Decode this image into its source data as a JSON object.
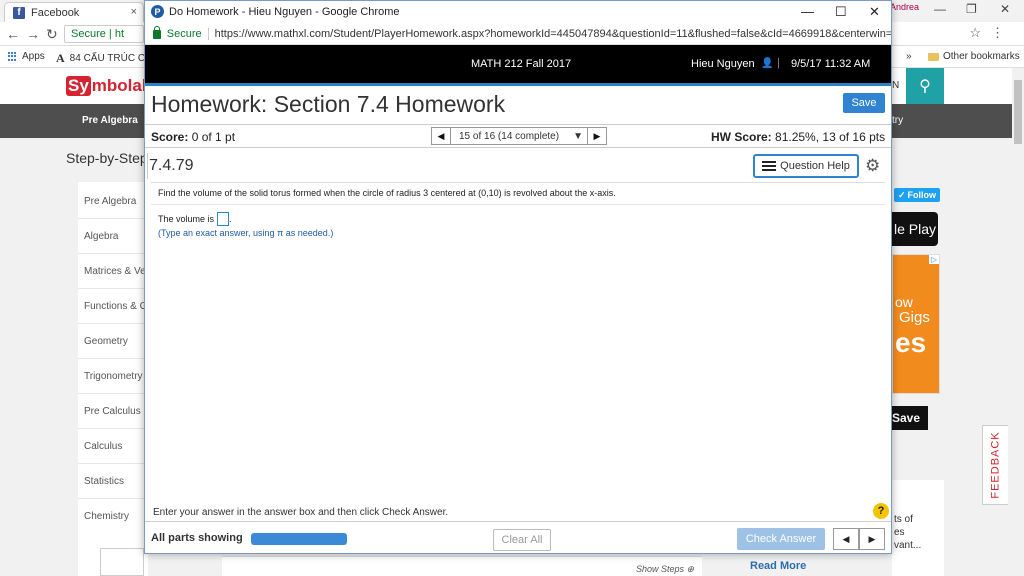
{
  "background": {
    "tab_title": "Facebook",
    "tab_close": "×",
    "window_controls": [
      "—",
      "❐",
      "✕"
    ],
    "window_partial_label": "Andrea",
    "omnibox_prefix": "Secure | ht",
    "bookmarks": {
      "apps_label": "Apps",
      "item1_prefix": "A",
      "item1_label": "84 CẤU TRÚC CÂ",
      "more": "»",
      "other_label": "Other bookmarks"
    },
    "symbolab": {
      "logo_sy": "Sy",
      "logo_rest": "mbolab",
      "nav_item": "Pre Algebra",
      "nav_right": "try",
      "hidden_n": "N",
      "page_title": "Step-by-Step",
      "sidebar_items": [
        "Pre Algebra",
        "Algebra",
        "Matrices & Ve",
        "Functions & G",
        "Geometry",
        "Trigonometry",
        "Pre Calculus",
        "Calculus",
        "Statistics",
        "Chemistry"
      ],
      "follow_label": "Follow",
      "gplay_label": "le Play",
      "ad_badge": "▷",
      "ad_low": "ow",
      "ad_gigs": "Gigs",
      "ad_es": "es",
      "ad_save": "Save",
      "feedback_label": "FEEDBACK",
      "lower_text": [
        "ts of",
        "es",
        "vant..."
      ],
      "show_steps": "Show Steps",
      "read_more": "Read More"
    }
  },
  "popup": {
    "icon_letter": "P",
    "window_title": "Do Homework - Hieu Nguyen - Google Chrome",
    "window_controls": [
      "—",
      "☐",
      "✕"
    ],
    "secure_label": "Secure",
    "url": "https://www.mathxl.com/Student/PlayerHomework.aspx?homeworkId=445047894&questionId=11&flushed=false&cId=4669918&centerwin=yes",
    "course_name": "MATH 212 Fall 2017",
    "user_name": "Hieu Nguyen",
    "user_icon": "👤",
    "separator": "|",
    "datetime": "9/5/17 11:32 AM",
    "hw_title": "Homework: Section 7.4 Homework",
    "save_label": "Save",
    "score_prefix": "Score:",
    "score_value": "0 of 1 pt",
    "question_nav": "15 of 16 (14 complete)",
    "hw_score_prefix": "HW Score:",
    "hw_score_value": "81.25%, 13 of 16 pts",
    "question_number": "7.4.79",
    "question_help_label": "Question Help",
    "question_text": "Find the volume of the solid torus formed when the circle of radius 3 centered at (0,10) is revolved about the x-axis.",
    "answer_prefix": "The volume is",
    "answer_suffix": ".",
    "answer_hint": "(Type an exact answer, using π as needed.)",
    "instruction": "Enter your answer in the answer box and then click Check Answer.",
    "help_symbol": "?",
    "parts_label": "All parts showing",
    "progress_fraction": 1.0,
    "clear_label": "Clear All",
    "check_label": "Check Answer",
    "accent_color": "#2f83d0",
    "header_bar_color": "#000000"
  }
}
